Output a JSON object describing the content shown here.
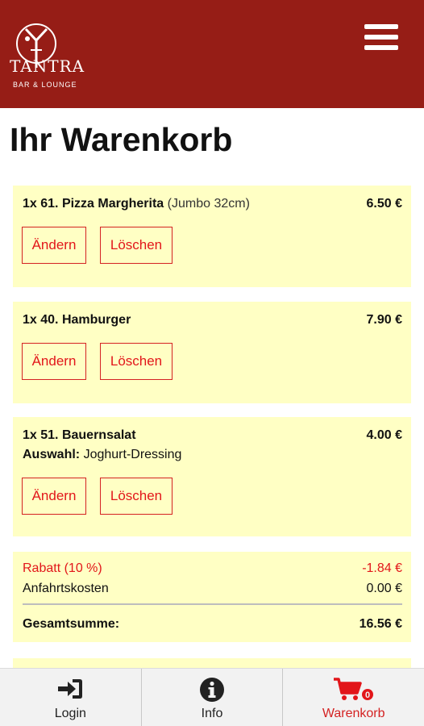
{
  "header": {
    "logo_text": "TANTRA",
    "logo_sub": "BAR & LOUNGE",
    "menu_icon": "hamburger-menu-icon",
    "background": "#961d16"
  },
  "page_title": "Ihr Warenkorb",
  "cart": {
    "items": [
      {
        "qty": "1x",
        "name": "61. Pizza Margherita",
        "variant": "(Jumbo 32cm)",
        "price": "6.50 €",
        "edit_label": "Ändern",
        "delete_label": "Löschen"
      },
      {
        "qty": "1x",
        "name": "40. Hamburger",
        "price": "7.90 €",
        "edit_label": "Ändern",
        "delete_label": "Löschen"
      },
      {
        "qty": "1x",
        "name": "51. Bauernsalat",
        "price": "4.00 €",
        "selection_label": "Auswahl:",
        "selection_value": "Joghurt-Dressing",
        "edit_label": "Ändern",
        "delete_label": "Löschen"
      }
    ],
    "summary": {
      "discount_label": "Rabatt (10 %)",
      "discount_value": "-1.84 €",
      "delivery_label": "Anfahrtskosten",
      "delivery_value": "0.00 €",
      "total_label": "Gesamtsumme:",
      "total_value": "16.56 €"
    }
  },
  "tabbar": {
    "tabs": [
      {
        "label": "Login",
        "icon": "login-icon"
      },
      {
        "label": "Info",
        "icon": "info-icon"
      },
      {
        "label": "Warenkorb",
        "icon": "cart-icon",
        "badge": "0",
        "active": true
      }
    ]
  },
  "colors": {
    "accent_red": "#e2161a",
    "card_bg": "#ffffc4",
    "header_bg": "#961d16"
  }
}
